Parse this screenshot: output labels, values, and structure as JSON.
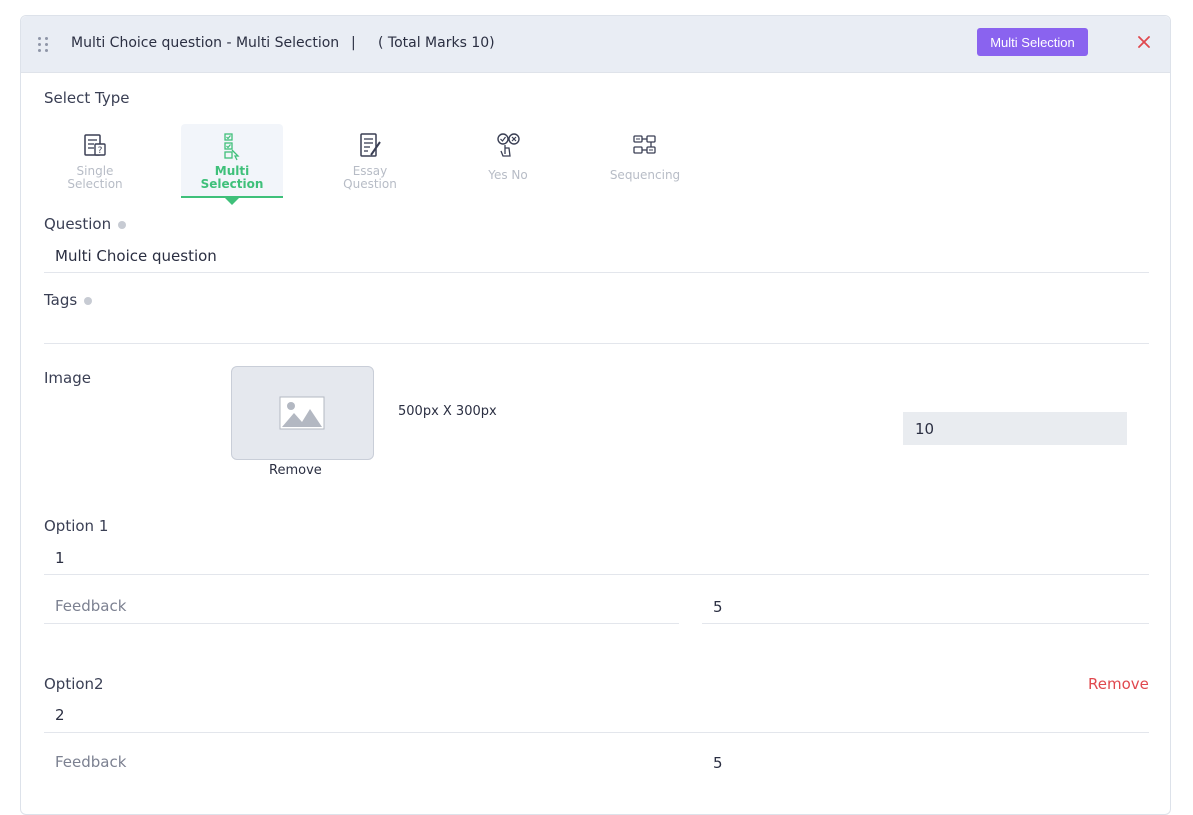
{
  "header": {
    "title": "Multi Choice question - Multi Selection",
    "separator": "|",
    "marks": "( Total Marks 10)",
    "type_badge": "Multi Selection",
    "colors": {
      "badge": "#8a63ef",
      "close": "#e0484e",
      "active": "#3fc07a"
    }
  },
  "select_type": {
    "label": "Select Type",
    "types": [
      {
        "line1": "Single",
        "line2": "Selection",
        "icon": "single-selection-icon"
      },
      {
        "line1": "Multi",
        "line2": "Selection",
        "icon": "multi-selection-icon"
      },
      {
        "line1": "Essay",
        "line2": "Question",
        "icon": "essay-question-icon"
      },
      {
        "line1": "Yes No",
        "line2": "",
        "icon": "yes-no-icon"
      },
      {
        "line1": "Sequencing",
        "line2": "",
        "icon": "sequencing-icon"
      }
    ],
    "active": "Multi Selection"
  },
  "question": {
    "label": "Question",
    "value": "Multi Choice question"
  },
  "tags": {
    "label": "Tags",
    "value": ""
  },
  "image": {
    "label": "Image",
    "remove": "Remove",
    "size_hint": "500px X 300px",
    "marks_value": "10"
  },
  "options": [
    {
      "label": "Option 1",
      "value": "1",
      "feedback_placeholder": "Feedback",
      "score": "5",
      "remove": ""
    },
    {
      "label": "Option2",
      "value": "2",
      "feedback_placeholder": "Feedback",
      "score": "5",
      "remove": "Remove"
    }
  ]
}
